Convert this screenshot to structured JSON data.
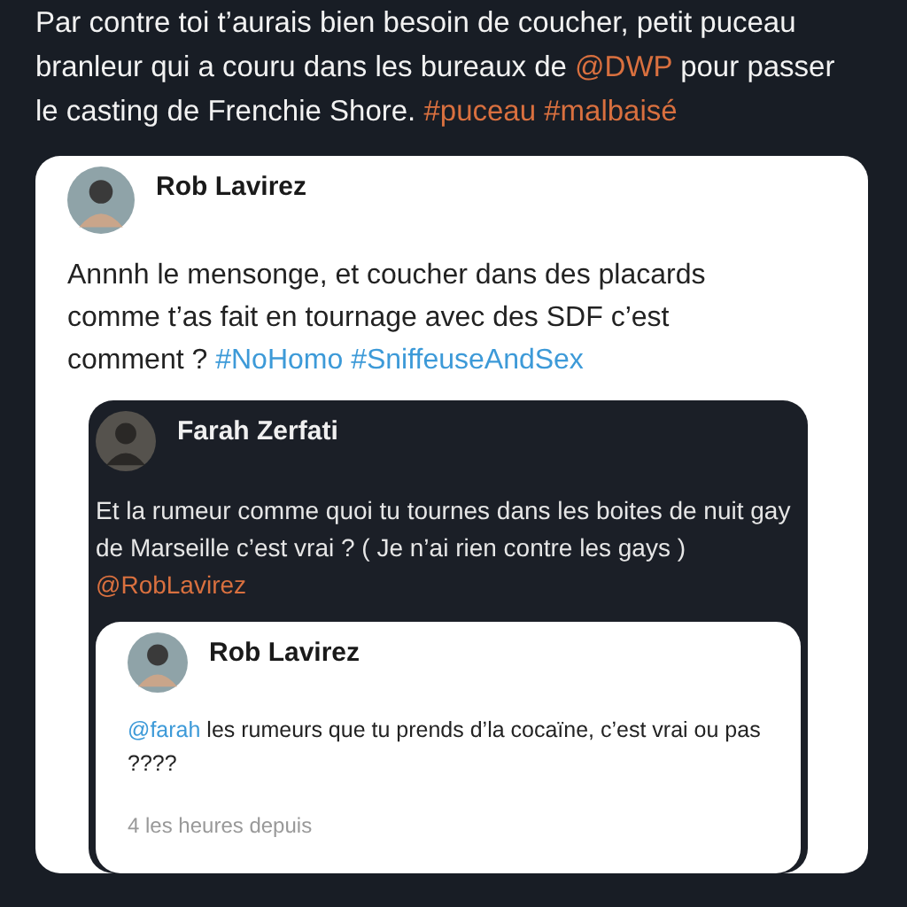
{
  "post": {
    "body": [
      {
        "kind": "text",
        "text": "Par contre toi t’aurais bien besoin de coucher, petit puceau branleur qui a couru dans les bureaux de "
      },
      {
        "kind": "mention",
        "text": "@DWP"
      },
      {
        "kind": "text",
        "text": " pour passer le casting de Frenchie Shore. "
      },
      {
        "kind": "hashtag",
        "text": "#puceau #malbaisé"
      }
    ]
  },
  "quote": {
    "author": "Rob Lavirez",
    "body": [
      {
        "kind": "text",
        "text": "Annnh le mensonge, et coucher dans des placards comme t’as fait en tournage avec des SDF c’est comment ? "
      },
      {
        "kind": "hashtag",
        "text": "#NoHomo #SniffeuseAndSex"
      }
    ],
    "quote": {
      "author": "Farah Zerfati",
      "body": [
        {
          "kind": "text",
          "text": "Et la rumeur comme quoi tu tournes dans les boites de nuit gay de Marseille c’est vrai ? ( Je n’ai rien contre les gays ) "
        },
        {
          "kind": "mention",
          "text": "@RobLavirez"
        }
      ],
      "quote": {
        "author": "Rob Lavirez",
        "body": [
          {
            "kind": "mention",
            "text": "@farah"
          },
          {
            "kind": "text",
            "text": " les rumeurs que tu prends d’la cocaïne, c’est vrai ou pas ????"
          }
        ],
        "time": "4 les heures depuis"
      }
    }
  }
}
